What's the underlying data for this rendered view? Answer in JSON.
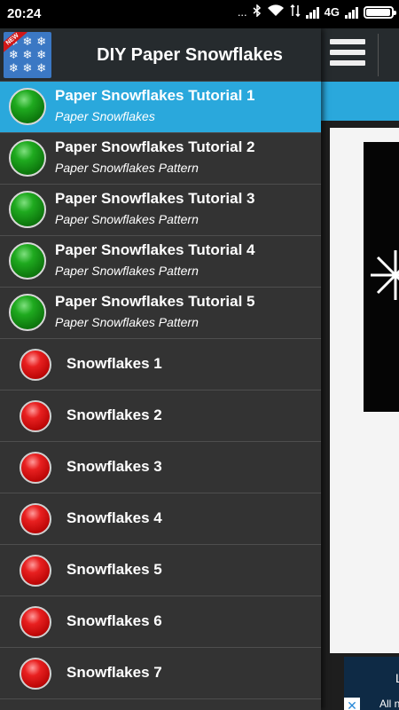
{
  "status_bar": {
    "time": "20:24",
    "dots": "...",
    "network": "4G",
    "battery_level": 0.95
  },
  "main": {
    "menu_icon": "hamburger-menu-icon",
    "ad": {
      "text": "L",
      "subtext": "All ne",
      "close_icon": "close-icon",
      "close_glyph": "✕"
    }
  },
  "drawer": {
    "logo": {
      "badge": "NEW",
      "icon": "snowflake-app-icon"
    },
    "title": "DIY Paper Snowflakes",
    "items": [
      {
        "title": "Paper Snowflakes Tutorial 1",
        "subtitle": "Paper Snowflakes",
        "color": "green",
        "active": true
      },
      {
        "title": "Paper Snowflakes Tutorial 2",
        "subtitle": "Paper Snowflakes Pattern",
        "color": "green"
      },
      {
        "title": "Paper Snowflakes Tutorial 3",
        "subtitle": "Paper Snowflakes Pattern",
        "color": "green"
      },
      {
        "title": "Paper Snowflakes Tutorial 4",
        "subtitle": "Paper Snowflakes Pattern",
        "color": "green"
      },
      {
        "title": "Paper Snowflakes Tutorial 5",
        "subtitle": "Paper Snowflakes Pattern",
        "color": "green"
      },
      {
        "title": "Snowflakes 1",
        "color": "red"
      },
      {
        "title": "Snowflakes 2",
        "color": "red"
      },
      {
        "title": "Snowflakes 3",
        "color": "red"
      },
      {
        "title": "Snowflakes 4",
        "color": "red"
      },
      {
        "title": "Snowflakes 5",
        "color": "red"
      },
      {
        "title": "Snowflakes 6",
        "color": "red"
      },
      {
        "title": "Snowflakes 7",
        "color": "red"
      }
    ]
  },
  "colors": {
    "accent": "#2aa8dc",
    "drawer_bg": "#333333",
    "header_bg": "#262b2e",
    "green_ball": "#1faa1f",
    "red_ball": "#e82020"
  }
}
